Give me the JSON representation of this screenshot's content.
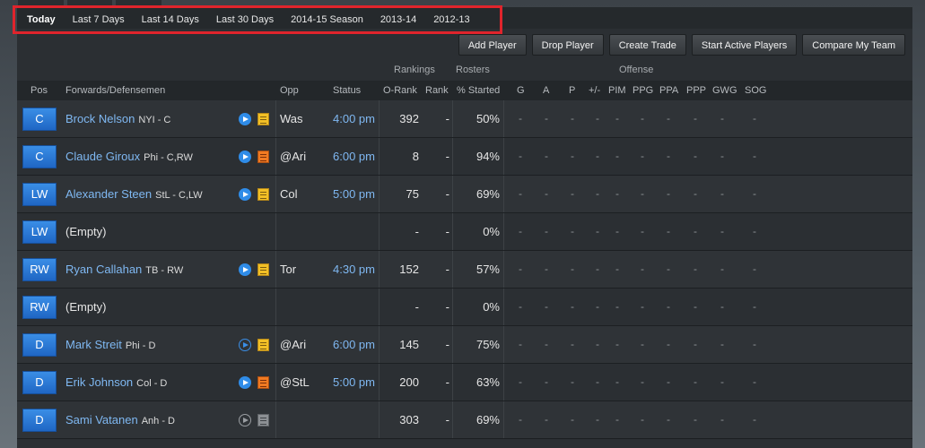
{
  "date_ranges": [
    "Today",
    "Last 7 Days",
    "Last 14 Days",
    "Last 30 Days",
    "2014-15 Season",
    "2013-14",
    "2012-13"
  ],
  "active_range": "Today",
  "actions": {
    "add_player": "Add Player",
    "drop_player": "Drop Player",
    "create_trade": "Create Trade",
    "start_active": "Start Active Players",
    "compare_team": "Compare My Team"
  },
  "groups": {
    "rankings": "Rankings",
    "rosters": "Rosters",
    "offense": "Offense"
  },
  "headers": {
    "pos": "Pos",
    "players": "Forwards/Defensemen",
    "opp": "Opp",
    "status": "Status",
    "orank": "O-Rank",
    "rank": "Rank",
    "started": "% Started",
    "stats": [
      "G",
      "A",
      "P",
      "+/-",
      "PIM",
      "PPG",
      "PPA",
      "PPP",
      "GWG",
      "SOG"
    ]
  },
  "players": [
    {
      "pos": "C",
      "name": "Brock Nelson",
      "team": "NYI - C",
      "opp": "Was",
      "status": "4:00 pm",
      "orank": "392",
      "rank": "-",
      "started": "50%",
      "play": "play-icon",
      "note": "notes-icon",
      "note_color": "yellow",
      "play_style": "solid"
    },
    {
      "pos": "C",
      "name": "Claude Giroux",
      "team": "Phi - C,RW",
      "opp": "@Ari",
      "status": "6:00 pm",
      "orank": "8",
      "rank": "-",
      "started": "94%",
      "play": "play-icon",
      "note": "notes-icon",
      "note_color": "orange",
      "play_style": "solid"
    },
    {
      "pos": "LW",
      "name": "Alexander Steen",
      "team": "StL - C,LW",
      "opp": "Col",
      "status": "5:00 pm",
      "orank": "75",
      "rank": "-",
      "started": "69%",
      "play": "play-icon",
      "note": "notes-icon",
      "note_color": "yellow",
      "play_style": "solid"
    },
    {
      "pos": "LW",
      "name": "(Empty)",
      "team": "",
      "opp": "",
      "status": "",
      "orank": "-",
      "rank": "-",
      "started": "0%",
      "play": "",
      "note": "",
      "note_color": "",
      "play_style": ""
    },
    {
      "pos": "RW",
      "name": "Ryan Callahan",
      "team": "TB - RW",
      "opp": "Tor",
      "status": "4:30 pm",
      "orank": "152",
      "rank": "-",
      "started": "57%",
      "play": "play-icon",
      "note": "notes-icon",
      "note_color": "yellow",
      "play_style": "solid"
    },
    {
      "pos": "RW",
      "name": "(Empty)",
      "team": "",
      "opp": "",
      "status": "",
      "orank": "-",
      "rank": "-",
      "started": "0%",
      "play": "",
      "note": "",
      "note_color": "",
      "play_style": ""
    },
    {
      "pos": "D",
      "name": "Mark Streit",
      "team": "Phi - D",
      "opp": "@Ari",
      "status": "6:00 pm",
      "orank": "145",
      "rank": "-",
      "started": "75%",
      "play": "play-icon",
      "note": "notes-icon",
      "note_color": "yellow",
      "play_style": "outline"
    },
    {
      "pos": "D",
      "name": "Erik Johnson",
      "team": "Col - D",
      "opp": "@StL",
      "status": "5:00 pm",
      "orank": "200",
      "rank": "-",
      "started": "63%",
      "play": "play-icon",
      "note": "notes-icon",
      "note_color": "orange",
      "play_style": "solid"
    },
    {
      "pos": "D",
      "name": "Sami Vatanen",
      "team": "Anh - D",
      "opp": "",
      "status": "",
      "orank": "303",
      "rank": "-",
      "started": "69%",
      "play": "play-icon",
      "note": "notes-icon",
      "note_color": "gray",
      "play_style": "gray"
    }
  ],
  "stat_placeholder": "-"
}
